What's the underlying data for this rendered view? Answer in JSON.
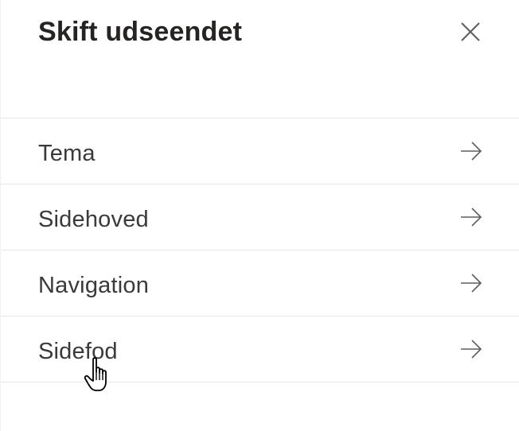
{
  "panel": {
    "title": "Skift udseendet",
    "close_icon": "close-icon"
  },
  "menu": {
    "items": [
      {
        "label": "Tema",
        "icon": "arrow-right-icon"
      },
      {
        "label": "Sidehoved",
        "icon": "arrow-right-icon"
      },
      {
        "label": "Navigation",
        "icon": "arrow-right-icon"
      },
      {
        "label": "Sidefod",
        "icon": "arrow-right-icon"
      }
    ]
  },
  "cursor": {
    "icon": "hand-pointer-icon"
  },
  "colors": {
    "text": "#323130",
    "title": "#252423",
    "divider": "#e8e6e4",
    "icon": "#605e5c"
  }
}
